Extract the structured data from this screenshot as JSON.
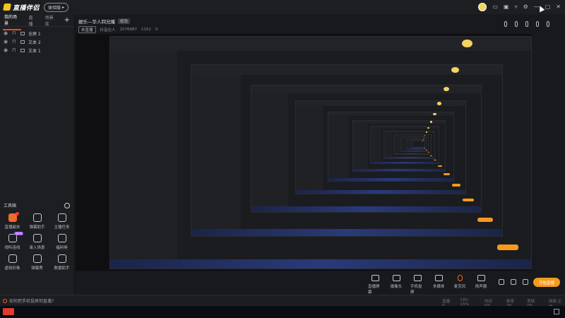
{
  "app": {
    "name": "直播伴侣",
    "version_label": "体验版",
    "window_controls": [
      "avatar",
      "message-icon",
      "layout-icon",
      "skin-icon",
      "settings-icon",
      "minimize-icon",
      "maximize-icon",
      "close-icon"
    ]
  },
  "scenes": {
    "tabs": [
      {
        "label": "我的场景"
      },
      {
        "label": "直播"
      },
      {
        "label": "场景库"
      }
    ],
    "add_label": "+"
  },
  "sources": [
    {
      "label": "全屏 1"
    },
    {
      "label": "文本 2"
    },
    {
      "label": "文本 1"
    }
  ],
  "tools": {
    "title": "工具箱",
    "items": [
      {
        "label": "直播副本",
        "icon": "broadcast-icon",
        "badge": ""
      },
      {
        "label": "弹幕助手",
        "icon": "danmu-icon",
        "badge": ""
      },
      {
        "label": "主播任务",
        "icon": "task-icon",
        "badge": ""
      },
      {
        "label": "视听连线",
        "icon": "link-icon",
        "badge": "NEW"
      },
      {
        "label": "录入场景",
        "icon": "import-icon",
        "badge": ""
      },
      {
        "label": "福利券",
        "icon": "coupon-icon",
        "badge": ""
      },
      {
        "label": "虚拟形象",
        "icon": "avatar-icon",
        "badge": ""
      },
      {
        "label": "弹幕秀",
        "icon": "danmu-show-icon",
        "badge": ""
      },
      {
        "label": "数据助手",
        "icon": "data-icon",
        "badge": ""
      }
    ]
  },
  "room": {
    "title": "娱乐—华人四兄播",
    "edit_label": "修改",
    "status": "未直播",
    "name": "抖音达人",
    "id": "1576987",
    "fans": "1151",
    "likes": "0"
  },
  "bottom_tools": [
    {
      "label": "直播屏幕",
      "icon": "screen-icon"
    },
    {
      "label": "摄像头",
      "icon": "camera-icon"
    },
    {
      "label": "手机投屏",
      "icon": "phone-cast-icon"
    },
    {
      "label": "多媒体",
      "icon": "media-icon"
    },
    {
      "label": "麦克风",
      "icon": "mic-icon"
    },
    {
      "label": "扬声器",
      "icon": "speaker-icon"
    }
  ],
  "go_live_label": "开始直播",
  "status_tip": "如何把手机投屏到直播?",
  "stats": [
    "直播 0",
    "CPU 15%",
    "内存 0%",
    "帧率 29",
    "丢帧 0%",
    "网络 正常"
  ],
  "colors": {
    "accent": "#f59a1e",
    "brand_red": "#e94b2a",
    "bg": "#18191c"
  }
}
